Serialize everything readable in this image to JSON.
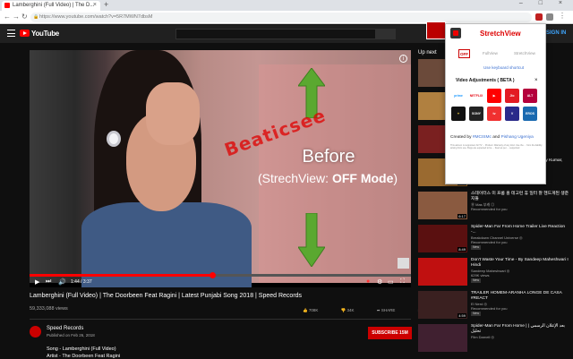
{
  "browser": {
    "tab_title": "Lamberghini (Full Video) | The D...",
    "url": "https://www.youtube.com/watch?v=5R7MWN7dbsM"
  },
  "youtube": {
    "brand": "YouTube",
    "signin": "SIGN IN",
    "up_next": "Up next"
  },
  "video": {
    "overlay_before": "Before",
    "overlay_mode_prefix": "(StrechView: ",
    "overlay_mode_bold": "OFF Mode",
    "overlay_mode_suffix": ")",
    "watermark": "Beaticsee",
    "time": "1:44 / 3:37",
    "progress": 0.48,
    "title": "Lamberghini (Full Video) | The Doorbeen Feat Ragini | Latest Punjabi Song 2018 | Speed Records",
    "views": "59,333,088 views",
    "likes": "708K",
    "dislikes": "34K",
    "share": "SHARE",
    "save": "SAVE",
    "channel": "Speed Records",
    "published": "Published on Feb 26, 2018",
    "subscribe": "SUBSCRIBE 15M",
    "desc_line1": "Song - Lamberghini (Full Video)",
    "desc_line2": "Artist - The Doorbeen Feat Ragini"
  },
  "recommendations": [
    {
      "title": "",
      "channel": "",
      "duration": "",
      "thumb_color": "#6b4a3a"
    },
    {
      "title": "",
      "channel": "",
      "duration": "",
      "thumb_color": "#b08040"
    },
    {
      "title": "",
      "channel": "",
      "duration": "14:29",
      "thumb_color": "#7a2020"
    },
    {
      "title": "Entertainment Comedy Scenes | Akshay Kumar, Tamannaah...",
      "channel": "All Time Hits",
      "duration": "1:23",
      "thumb_color": "#9a6a30"
    },
    {
      "title": "스테이터스 미 프롬 홈 테고런 휴 일터 잘 헨드게된 생준지들",
      "channel": "Ⓑ Mas 부캐 ◎\nRecommended for you",
      "duration": "6:17",
      "thumb_color": "#8a5a40"
    },
    {
      "title": "Spider-Man Far From Home Trailer Live Reaction -...",
      "channel": "Breakdown Channel Universe ◎\nRecommended for you",
      "duration": "8:49",
      "thumb_color": "#5a1010",
      "new": "New"
    },
    {
      "title": "Don't Waste Your Time - By Sandeep Maheshwari I Hindi",
      "channel": "Sandeep Maheshwari ◎\n629K views",
      "duration": "",
      "thumb_color": "#c01010",
      "new": "New"
    },
    {
      "title": "TRAILER HOMEM-ARANHA LONGE DE CASA #REACT",
      "channel": "El Nerd ◎\nRecommended for you",
      "duration": "4:59",
      "thumb_color": "#3a2020",
      "new": "New"
    },
    {
      "title": "Spider-Man Far From Home | بعد الإعلان الرسمي | تحليل",
      "channel": "Film Darnell ◎",
      "duration": "",
      "thumb_color": "#402030"
    }
  ],
  "stretchview": {
    "title": "StretchView",
    "mode_off": "OFF",
    "mode_fullview": "FullView",
    "mode_stretchview": "StretchView",
    "keyboard_hint": "Use keyboard shortcut",
    "video_adjustments": "Video Adjustments ( BETA )",
    "close": "×",
    "created_prefix": "Created by ",
    "created_link1": "#MCISMc",
    "created_mid": " and ",
    "created_link2": "Pishang Ugeniya",
    "fine_print": "This add-on is supported. All TV ... Product. Warranty of any kind. Use the ... from the liability arising from use. Bugs are expected to be ... fixed as per ... supported",
    "tiles": [
      {
        "label": "prime video",
        "color": "#1a98ff",
        "bg": "#ffffff"
      },
      {
        "label": "NETFLIX",
        "color": "#e50914",
        "bg": "#ffffff"
      },
      {
        "label": "▶",
        "color": "#ffffff",
        "bg": "#ff0000"
      },
      {
        "label": "Jio",
        "color": "#ffffff",
        "bg": "#e31b23"
      },
      {
        "label": "ALT",
        "color": "#ffffff",
        "bg": "#b4003c"
      },
      {
        "label": "✦",
        "color": "#e0c040",
        "bg": "#111111"
      },
      {
        "label": "SONY",
        "color": "#ffffff",
        "bg": "#222222"
      },
      {
        "label": "tv",
        "color": "#ffffff",
        "bg": "#f03030"
      },
      {
        "label": "V",
        "color": "#ffffff",
        "bg": "#2a2a8a"
      },
      {
        "label": "EROS NOW",
        "color": "#ffffff",
        "bg": "#1a6ab0"
      }
    ]
  },
  "colors": {
    "youtube_red": "#ff0000",
    "accent_blue": "#3ea6ff",
    "arrow_green": "#5aa830"
  }
}
